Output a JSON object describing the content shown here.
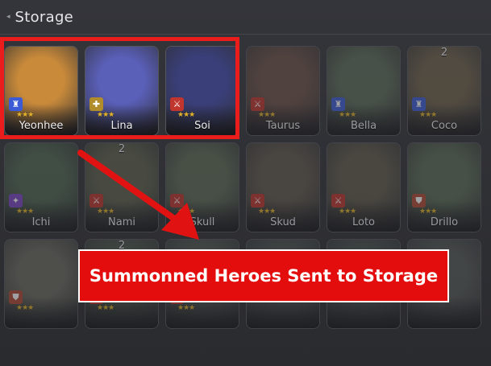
{
  "header": {
    "title": "Storage"
  },
  "heroes": [
    {
      "name": "Yeonhee",
      "count": "",
      "stars": "★★★",
      "badge_color": "#3b5bd6",
      "badge_glyph": "♜",
      "art": "#c98a3a"
    },
    {
      "name": "Lina",
      "count": "",
      "stars": "★★★",
      "badge_color": "#b08d2a",
      "badge_glyph": "✚",
      "art": "#5a5fb8"
    },
    {
      "name": "Soi",
      "count": "",
      "stars": "★★★",
      "badge_color": "#c0352d",
      "badge_glyph": "⚔",
      "art": "#3a3f7a"
    },
    {
      "name": "Taurus",
      "count": "",
      "stars": "★★★",
      "badge_color": "#c0352d",
      "badge_glyph": "⚔",
      "art": "#6a4f45"
    },
    {
      "name": "Bella",
      "count": "",
      "stars": "★★★",
      "badge_color": "#3b5bd6",
      "badge_glyph": "♜",
      "art": "#5b6b57"
    },
    {
      "name": "Coco",
      "count": "2",
      "stars": "★★★",
      "badge_color": "#3b5bd6",
      "badge_glyph": "♜",
      "art": "#6d6049"
    },
    {
      "name": "Ichi",
      "count": "",
      "stars": "★★★",
      "badge_color": "#7a45c2",
      "badge_glyph": "✦",
      "art": "#4e6650"
    },
    {
      "name": "Nami",
      "count": "2",
      "stars": "★★★",
      "badge_color": "#c0352d",
      "badge_glyph": "⚔",
      "art": "#5e614d"
    },
    {
      "name": "Skull",
      "count": "",
      "stars": "★★★",
      "badge_color": "#c0352d",
      "badge_glyph": "⚔",
      "art": "#5c6a55"
    },
    {
      "name": "Skud",
      "count": "",
      "stars": "★★★",
      "badge_color": "#c0352d",
      "badge_glyph": "⚔",
      "art": "#5f574b"
    },
    {
      "name": "Loto",
      "count": "",
      "stars": "★★★",
      "badge_color": "#c0352d",
      "badge_glyph": "⚔",
      "art": "#5f5a4a"
    },
    {
      "name": "Drillo",
      "count": "",
      "stars": "★★★",
      "badge_color": "#b04a33",
      "badge_glyph": "⛊",
      "art": "#5a6b55"
    },
    {
      "name": "",
      "count": "",
      "stars": "★★★",
      "badge_color": "#b04a33",
      "badge_glyph": "⛊",
      "art": "#6a6b60"
    },
    {
      "name": "",
      "count": "2",
      "stars": "★★★",
      "badge_color": "#c0352d",
      "badge_glyph": "⚔",
      "art": "#4f5a4d"
    },
    {
      "name": "",
      "count": "",
      "stars": "★★★",
      "badge_color": "#c0352d",
      "badge_glyph": "⚔",
      "art": "#545c55"
    },
    {
      "name": "",
      "count": "",
      "stars": "",
      "badge_color": "#c0352d",
      "badge_glyph": "",
      "art": "#4e5552"
    },
    {
      "name": "",
      "count": "",
      "stars": "",
      "badge_color": "#c0352d",
      "badge_glyph": "",
      "art": "#4b5350"
    },
    {
      "name": "",
      "count": "",
      "stars": "",
      "badge_color": "#c0352d",
      "badge_glyph": "",
      "art": "#555a57"
    }
  ],
  "callout": {
    "text": "Summonned Heroes Sent to Storage"
  },
  "colors": {
    "highlight": "#ea1c1c",
    "callout_bg": "#e30d0d",
    "star": "#e0b230"
  }
}
